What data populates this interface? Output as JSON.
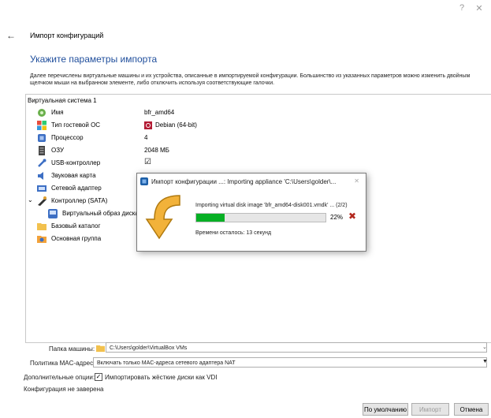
{
  "window": {
    "help_label": "?",
    "close_label": "✕"
  },
  "header": {
    "back_icon": "←",
    "title": "Импорт конфигураций"
  },
  "section_title": "Укажите параметры импорта",
  "description": "Далее перечислены виртуальные машины и их устройства, описанные в импортируемой конфигурации. Большинство из указанных параметров можно изменить двойным щелчком мыши на выбранном элементе, либо отключить используя соответствующие галочки.",
  "tree": {
    "root_label": "Виртуальная система 1",
    "rows": [
      {
        "label": "Имя",
        "value": "bfr_amd64",
        "icon": "name-icon",
        "color": "#6ab04c"
      },
      {
        "label": "Тип гостевой ОС",
        "value": "Debian (64-bit)",
        "icon": "os-type-icon",
        "color": "#d04a2a"
      },
      {
        "label": "Процессор",
        "value": "4",
        "icon": "cpu-icon",
        "color": "#3d6fc4"
      },
      {
        "label": "ОЗУ",
        "value": "2048 МБ",
        "icon": "ram-icon",
        "color": "#444444"
      },
      {
        "label": "USB-контроллер",
        "value": "☑",
        "icon": "usb-icon",
        "color": "#3d6fc4"
      },
      {
        "label": "Звуковая карта",
        "value": "",
        "icon": "audio-icon",
        "color": "#3d6fc4"
      },
      {
        "label": "Сетевой адаптер",
        "value": "",
        "icon": "network-icon",
        "color": "#3d6fc4"
      },
      {
        "label": "Контроллер (SATA)",
        "value": "",
        "icon": "controller-icon",
        "color": "#444444"
      },
      {
        "label": "Виртуальный образ диска",
        "value": "",
        "icon": "disk-image-icon",
        "color": "#3d6fc4"
      },
      {
        "label": "Базовый каталог",
        "value": "",
        "icon": "folder-icon",
        "color": "#f2c14e"
      },
      {
        "label": "Основная группа",
        "value": "",
        "icon": "group-icon",
        "color": "#f2a23a"
      }
    ]
  },
  "bottom": {
    "machine_folder_label": "Папка машины:",
    "machine_folder_value": "C:\\Users\\golder\\VirtualBox VMs",
    "mac_policy_label": "Политика MAC-адреса:",
    "mac_policy_value": "Включать только MAC-адреса сетевого адаптера NAT",
    "extra_options_label": "Дополнительные опции:",
    "import_vdi_label": "Импортировать жёсткие диски как VDI",
    "signature_status": "Конфигурация не заверена"
  },
  "buttons": {
    "defaults": "По умолчанию",
    "import": "Импорт",
    "cancel": "Отмена"
  },
  "dialog": {
    "title": "Импорт конфигурации ...: Importing appliance 'C:\\Users\\golder\\...",
    "close": "✕",
    "message": "Importing virtual disk image 'bfr_amd64-disk001.vmdk' ... (2/2)",
    "percent_text": "22%",
    "progress": 0.22,
    "time_left": "Времени осталось: 13 секунд",
    "cancel_icon": "✖"
  }
}
